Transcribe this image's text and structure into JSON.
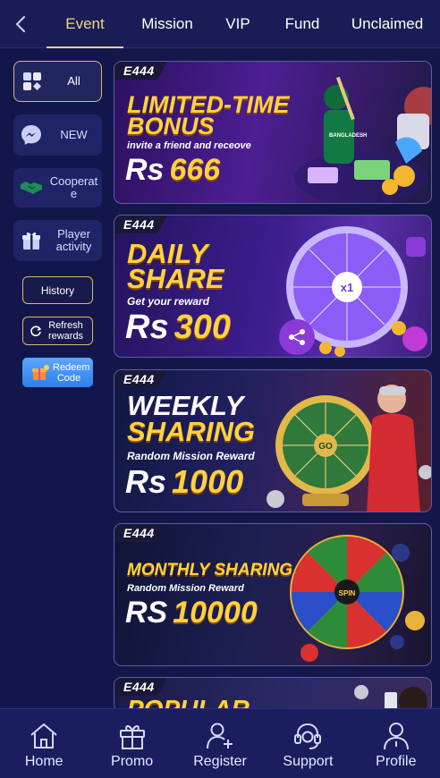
{
  "nav": {
    "tabs": [
      {
        "label": "Event",
        "active": true
      },
      {
        "label": "Mission",
        "active": false
      },
      {
        "label": "VIP",
        "active": false
      },
      {
        "label": "Fund",
        "active": false
      },
      {
        "label": "Unclaimed",
        "active": false
      }
    ]
  },
  "sidebar": {
    "categories": [
      {
        "label": "All",
        "icon": "grid-cards-icon",
        "active": true
      },
      {
        "label": "NEW",
        "icon": "messenger-icon",
        "active": false
      },
      {
        "label": "Cooperate",
        "icon": "handshake-icon",
        "active": false
      },
      {
        "label": "Player activity",
        "icon": "gift-icon",
        "active": false
      }
    ],
    "history_label": "History",
    "refresh_label": "Refresh rewards",
    "redeem_label": "Redeem Code"
  },
  "banners": [
    {
      "brand": "E444",
      "title_line1": "LIMITED-TIME",
      "title_line2": "BONUS",
      "subtitle": "invite a friend and receove",
      "currency": "Rs",
      "amount": "666"
    },
    {
      "brand": "E444",
      "title_line1": "DAILY",
      "title_line2": "SHARE",
      "subtitle": "Get your reward",
      "currency": "Rs",
      "amount": "300",
      "wheel_center": "x1"
    },
    {
      "brand": "E444",
      "title_line1": "WEEKLY",
      "title_line2": "SHARING",
      "subtitle": "Random Mission Reward",
      "currency": "Rs",
      "amount": "1000",
      "wheel_center": "GO"
    },
    {
      "brand": "E444",
      "title_line1": "MONTHLY SHARING",
      "subtitle": "Random Mission Reward",
      "currency": "RS",
      "amount": "10000",
      "wheel_center": "SPIN"
    },
    {
      "brand": "E444",
      "title_line1": "POPULAR"
    }
  ],
  "bottom_nav": [
    {
      "label": "Home",
      "icon": "home-icon"
    },
    {
      "label": "Promo",
      "icon": "gift-icon"
    },
    {
      "label": "Register",
      "icon": "add-user-icon"
    },
    {
      "label": "Support",
      "icon": "headset-icon"
    },
    {
      "label": "Profile",
      "icon": "user-icon"
    }
  ],
  "colors": {
    "background": "#15174a",
    "accent_gold": "#f2d48d",
    "headline_gold": "#ffd23f",
    "redeem_blue": "#3a8cf0"
  }
}
